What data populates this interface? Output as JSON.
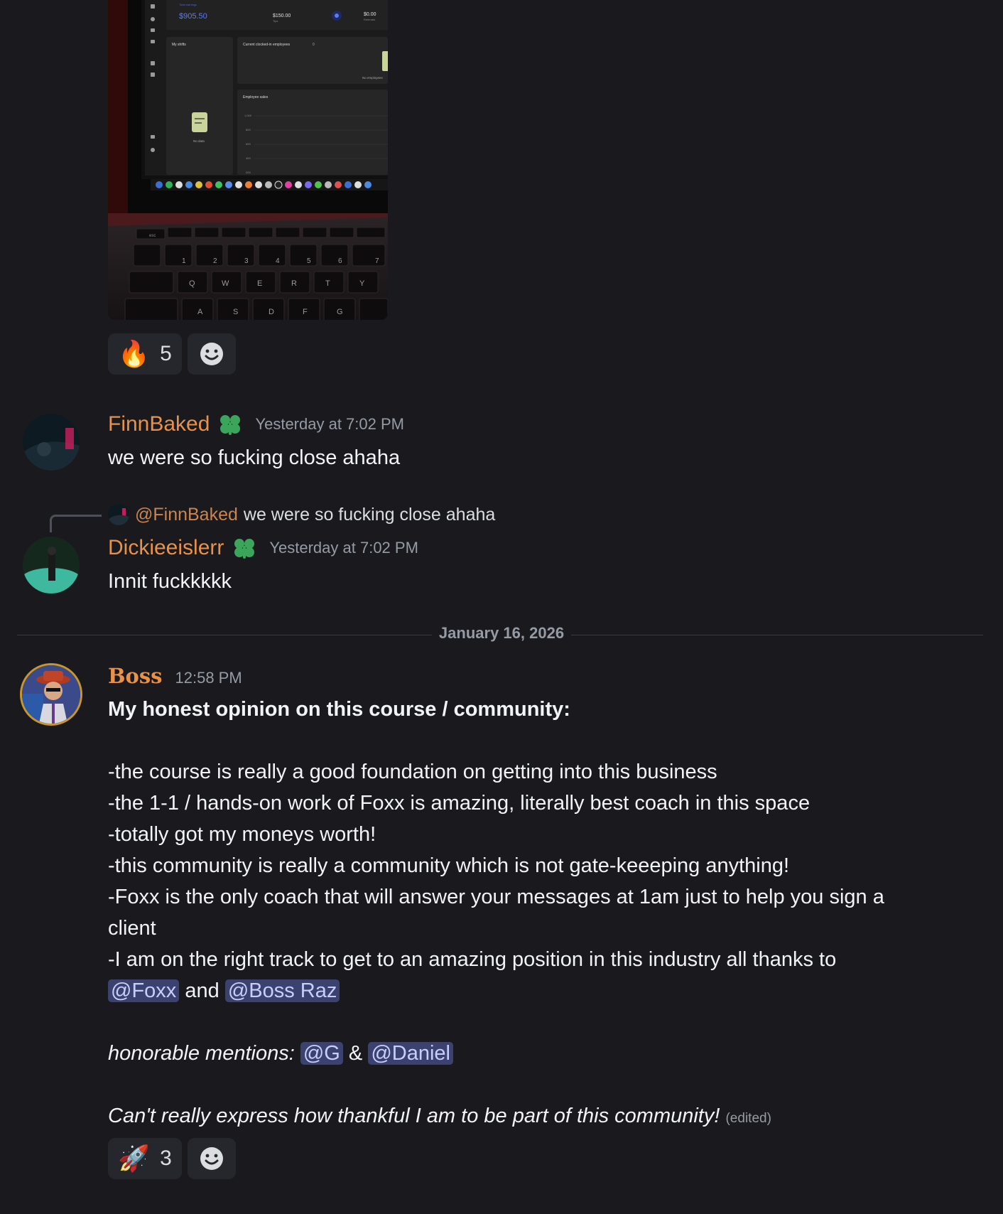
{
  "image_attachment": {
    "screen": {
      "total_earnings_label": "Total earnings",
      "total_earnings_value": "$905.50",
      "tips_value": "$150.00",
      "tips_label": "Tips",
      "referrals_value": "$0.00",
      "referrals_label": "Referrals",
      "my_shifts_label": "My shifts",
      "clocked_in_label": "Current clocked-in employees",
      "clocked_in_count": "0",
      "no_employees_label": "No employees",
      "employee_sales_label": "Employee sales",
      "no_data_label": "No data",
      "y_ticks": [
        "1,000",
        "800",
        "600",
        "400",
        "200"
      ]
    },
    "keyboard": {
      "row_numbers": [
        "1",
        "2",
        "3",
        "4",
        "5",
        "6",
        "7"
      ],
      "row_qwerty": [
        "Q",
        "W",
        "E",
        "R",
        "T",
        "Y"
      ],
      "row_asdf": [
        "A",
        "S",
        "D",
        "F",
        "G"
      ],
      "esc": "esc"
    }
  },
  "reactions_top": {
    "emoji": "🔥",
    "count": "5"
  },
  "messages": [
    {
      "username": "FinnBaked",
      "timestamp": "Yesterday at 7:02 PM",
      "text": "we were so fucking close ahaha"
    },
    {
      "reply_mention": "@FinnBaked",
      "reply_text": "we were so fucking close ahaha",
      "username": "Dickieeislerr",
      "timestamp": "Yesterday at 7:02 PM",
      "text": "Innit fuckkkkk"
    }
  ],
  "date_divider": "January 16, 2026",
  "boss_message": {
    "username": "Boss",
    "timestamp": "12:58 PM",
    "heading": "My honest opinion on this course / community:",
    "lines": [
      "-the course is really a good foundation on getting into this business",
      "-the 1-1 / hands-on work of Foxx is amazing, literally best coach in this space",
      "-totally got my moneys worth!",
      "-this community is really a community which is not gate-keeeping anything!",
      "-Foxx is the only coach that will answer your messages at 1am just to help you sign a",
      "client",
      "-I am on the right track to get to an amazing position in this industry all thanks to"
    ],
    "mention_foxx": "@Foxx",
    "and_word": "and",
    "mention_boss_raz": "@Boss Raz",
    "honorable_label": "honorable mentions:",
    "mention_g": "@G",
    "amp": "&",
    "mention_daniel": "@Daniel",
    "closing": "Can't really express how thankful I am to be part of this community!",
    "edited": "(edited)"
  },
  "reactions_bottom": {
    "emoji": "🚀",
    "count": "3"
  }
}
